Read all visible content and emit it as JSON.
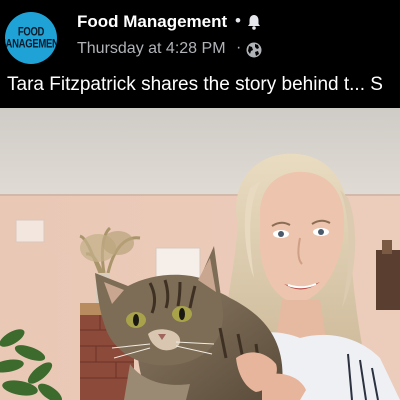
{
  "post": {
    "avatar_line1": "FOOD",
    "avatar_line2": "MANAGEMENT",
    "page_name": "Food Management",
    "name_separator": "•",
    "time": "Thursday at 4:28 PM",
    "time_separator": "·",
    "caption": "Tara Fitzpatrick shares the story behind t... S",
    "notification_icon": "bell-icon",
    "audience_icon": "globe-icon"
  },
  "video": {
    "description_icon": "video-frame",
    "colors": {
      "ceiling": "#d6d3ce",
      "wall": "#e9c7b6",
      "brand_blue": "#1fa3d6"
    }
  }
}
